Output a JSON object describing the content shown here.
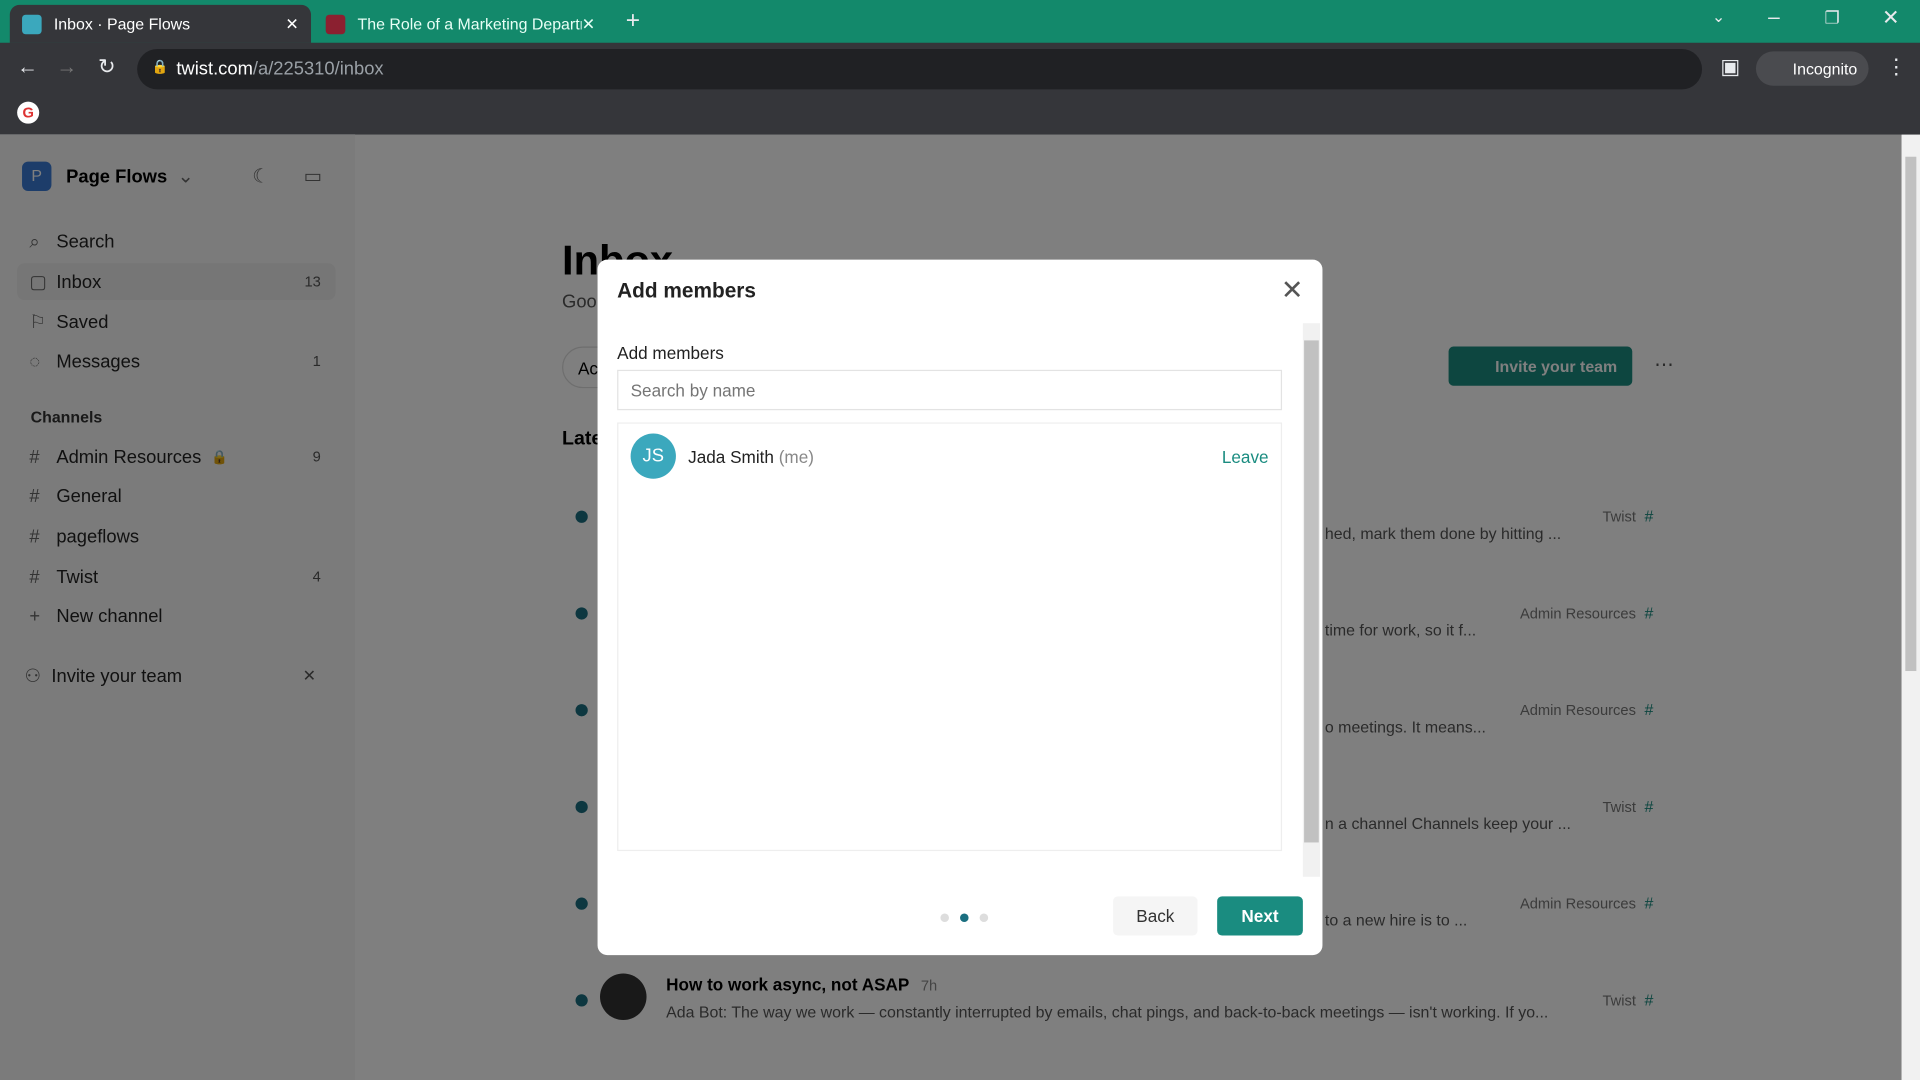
{
  "browser": {
    "tabs": [
      {
        "title": "Inbox · Page Flows",
        "active": true
      },
      {
        "title": "The Role of a Marketing Department",
        "active": false
      }
    ],
    "url_host": "twist.com",
    "url_path": "/a/225310/inbox",
    "profile": "Incognito"
  },
  "sidebar": {
    "workspace": "Page Flows",
    "workspace_initial": "P",
    "items": [
      {
        "label": "Search",
        "icon": "search-icon",
        "count": ""
      },
      {
        "label": "Inbox",
        "icon": "inbox-icon",
        "count": "13"
      },
      {
        "label": "Saved",
        "icon": "bookmark-icon",
        "count": ""
      },
      {
        "label": "Messages",
        "icon": "chat-icon",
        "count": "1"
      }
    ],
    "channels_heading": "Channels",
    "channels": [
      {
        "label": "Admin Resources",
        "count": "9",
        "locked": true
      },
      {
        "label": "General",
        "count": ""
      },
      {
        "label": "pageflows",
        "count": ""
      },
      {
        "label": "Twist",
        "count": "4"
      }
    ],
    "new_channel": "New channel",
    "invite": "Invite your team"
  },
  "main": {
    "title": "Inbox",
    "subtitle": "Goo",
    "filter": "Ac",
    "latest": "Late",
    "invite_button": "Invite your team",
    "threads": [
      {
        "snippet": "hed, mark them done by hitting ...",
        "channel": "Twist"
      },
      {
        "snippet": "time for work, so it f...",
        "channel": "Admin Resources"
      },
      {
        "snippet": "o meetings. It means...",
        "channel": "Admin Resources"
      },
      {
        "snippet": "n a channel Channels keep your ...",
        "channel": "Twist"
      },
      {
        "snippet": "to a new hire is to ...",
        "channel": "Admin Resources"
      },
      {
        "title": "How to work async, not ASAP",
        "time": "7h",
        "snippet": "Ada Bot: The way we work — constantly interrupted by emails, chat pings, and back-to-back meetings — isn't working. If yo...",
        "channel": "Twist"
      }
    ]
  },
  "modal": {
    "title": "Add members",
    "label": "Add members",
    "search_placeholder": "Search by name",
    "members": [
      {
        "initials": "JS",
        "name": "Jada Smith",
        "suffix": "(me)",
        "action": "Leave"
      }
    ],
    "steps_total": 3,
    "step_current": 2,
    "back": "Back",
    "next": "Next"
  },
  "colors": {
    "accent": "#1a8c80",
    "tabstrip": "#13896b",
    "avatar": "#3ba8bd"
  }
}
